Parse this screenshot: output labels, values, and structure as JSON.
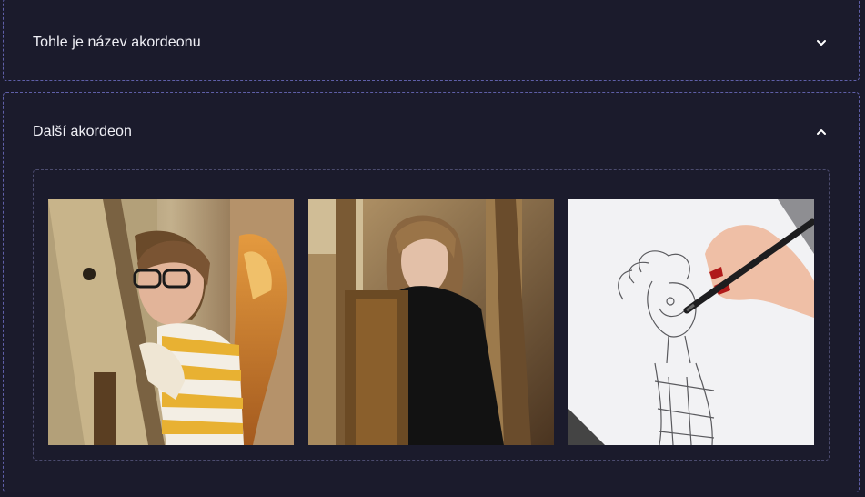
{
  "accordions": [
    {
      "title": "Tohle je název akordeonu",
      "expanded": false,
      "icon": "chevron-down-icon"
    },
    {
      "title": "Další akordeon",
      "expanded": true,
      "icon": "chevron-up-icon"
    }
  ],
  "gallery": {
    "images": [
      {
        "name": "girl-drawing-at-easel-photo"
      },
      {
        "name": "girl-behind-easel-photo"
      },
      {
        "name": "hand-sketching-on-tablet-photo"
      }
    ]
  },
  "colors": {
    "background": "#1a1a2b",
    "border": "#5f5fa8",
    "text": "#f0f0f6"
  }
}
